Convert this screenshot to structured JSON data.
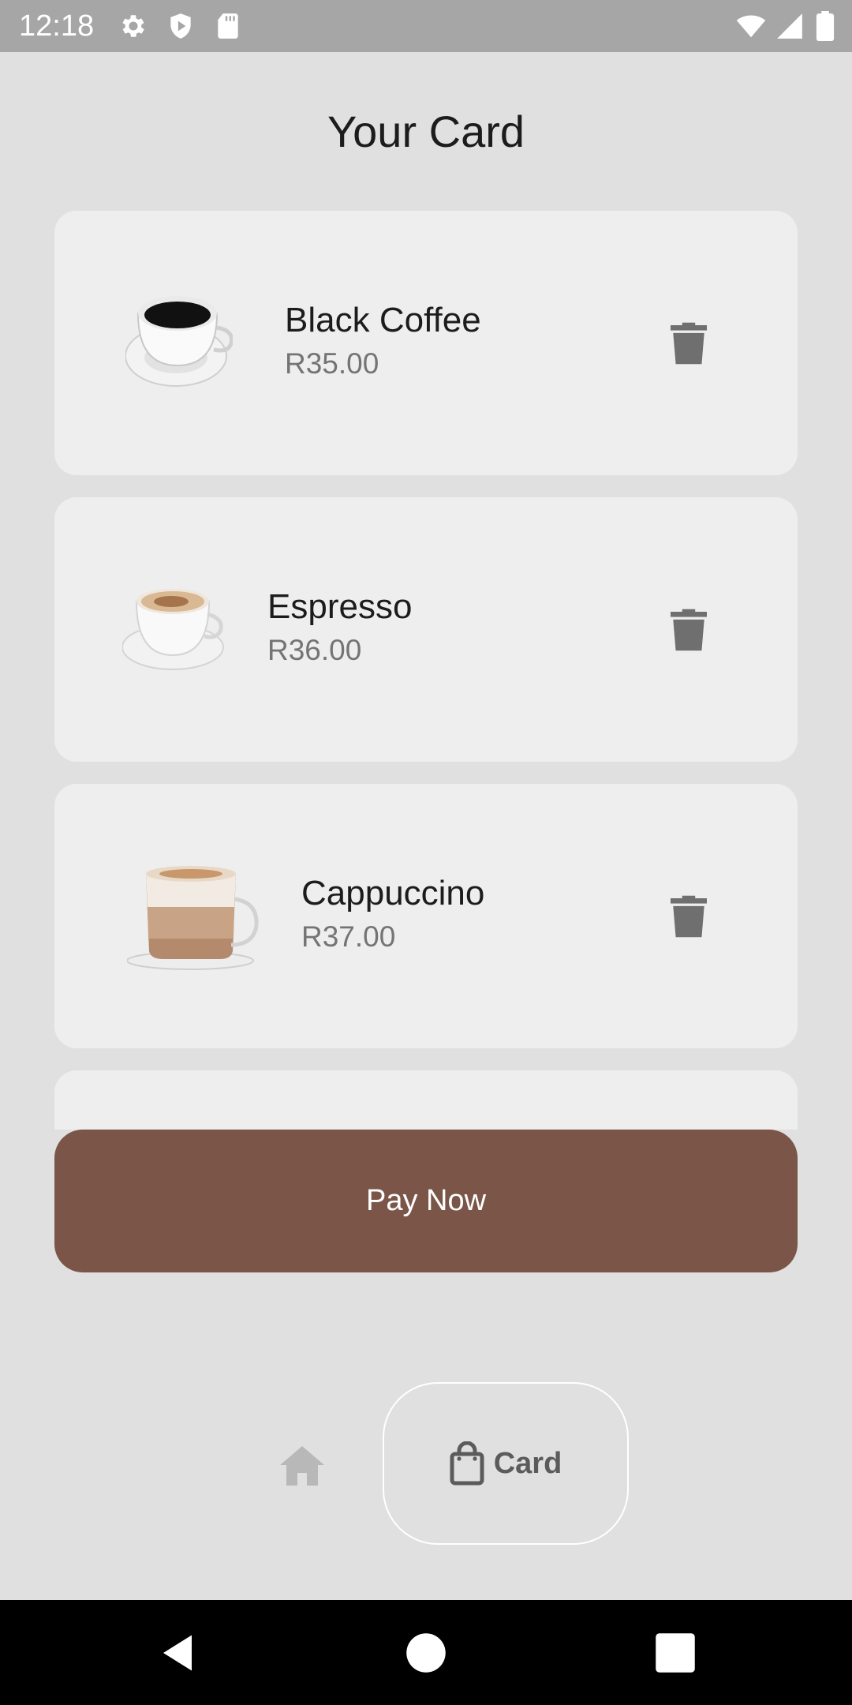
{
  "status_bar": {
    "time": "12:18",
    "left_icons": [
      "gear-icon",
      "shield-icon",
      "sd-card-icon"
    ],
    "right_icons": [
      "wifi-icon",
      "cell-signal-icon",
      "battery-icon"
    ]
  },
  "page": {
    "title": "Your Card"
  },
  "cart": {
    "items": [
      {
        "name": "Black Coffee",
        "price": "R35.00",
        "image": "black-coffee-cup-image"
      },
      {
        "name": "Espresso",
        "price": "R36.00",
        "image": "espresso-cup-image"
      },
      {
        "name": "Cappuccino",
        "price": "R37.00",
        "image": "cappuccino-glass-image"
      }
    ],
    "delete_icon": "trash-icon"
  },
  "pay_button": {
    "label": "Pay Now"
  },
  "bottom_nav": {
    "items": [
      {
        "icon": "home-icon",
        "label": "",
        "active": false
      },
      {
        "icon": "shopping-bag-icon",
        "label": "Card",
        "active": true
      }
    ]
  },
  "system_nav": {
    "buttons": [
      "back-icon",
      "home-circle-icon",
      "recents-icon"
    ]
  },
  "colors": {
    "background": "#e0e0e0",
    "card_background": "#eeeeee",
    "accent_brown": "#7a5548",
    "status_bar": "#a6a6a6"
  }
}
